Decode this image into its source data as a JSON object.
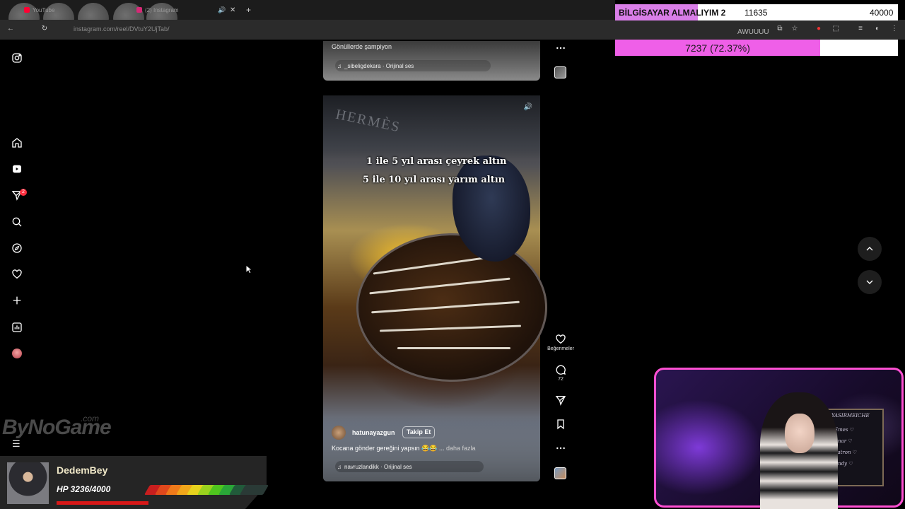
{
  "browser": {
    "tabs": [
      {
        "label": "YouTube",
        "color": "#ff0033"
      },
      {
        "label": "(2) Instagram",
        "color": "#d62976"
      }
    ],
    "url": "instagram.com/reel/DVtuY2UjTab/",
    "overlay_word": "AWUUUU"
  },
  "nav": {
    "items": [
      "instagram-icon",
      "home-icon",
      "reels-icon",
      "messages-icon",
      "search-icon",
      "explore-icon",
      "notifications-icon",
      "create-icon",
      "dashboard-icon",
      "profile-avatar"
    ],
    "notification_count": "2"
  },
  "prev_reel": {
    "caption": "Gönüllerde şampiyon",
    "audio": "_sibeligdekara · Orijinal ses"
  },
  "reel": {
    "brand_on_box": "HERMÈS",
    "overlay_line1": "1 ile 5 yıl arası çeyrek altın",
    "overlay_line2": "5 ile 10 yıl arası yarım altın",
    "author": "hatunayazgun",
    "follow_label": "Takip Et",
    "caption": "Kocana gönder gereğini yapsın 😂😂 ...",
    "more_label": "daha fazla",
    "audio": "navruzlandikk · Orijinal ses"
  },
  "actions": {
    "like_label": "Beğenmeler",
    "comments_count": "72"
  },
  "goal": {
    "title": "BİLGİSAYAR ALMALIYIM 2",
    "current": "11635",
    "target": "40000",
    "progress_text": "7237 (72.37%)",
    "progress_fraction": 0.7237,
    "accent": "#ef5fe8"
  },
  "hp_widget": {
    "name": "DedemBey",
    "hp_text": "HP 3236/4000",
    "hp_fraction": 0.809
  },
  "logo": {
    "text": "ByNoGame",
    "suffix": ".com"
  },
  "webcam_board": {
    "line1": "YASIRMEICHE",
    "line2": "Emes ♡",
    "line3": "Anar ♡",
    "line4": "Patron ♡",
    "line5": "Andy ♡"
  }
}
